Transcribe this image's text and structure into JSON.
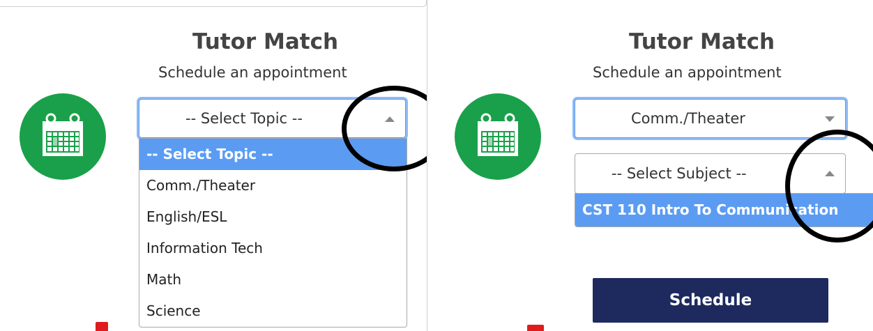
{
  "colors": {
    "calendar_green": "#1aa04a",
    "highlight_blue": "#5b9cf2",
    "focus_ring": "#8fbaf5",
    "button_navy": "#1e2a5e",
    "title_gray": "#444444"
  },
  "left": {
    "title": "Tutor Match",
    "subtitle": "Schedule an appointment",
    "topic_select": {
      "value": "-- Select Topic --",
      "state": "open",
      "arrow_icon": "chevron-up-icon"
    },
    "topic_options": [
      {
        "label": "-- Select Topic --",
        "highlighted": true
      },
      {
        "label": "Comm./Theater",
        "highlighted": false
      },
      {
        "label": "English/ESL",
        "highlighted": false
      },
      {
        "label": "Information Tech",
        "highlighted": false
      },
      {
        "label": "Math",
        "highlighted": false
      },
      {
        "label": "Science",
        "highlighted": false
      }
    ]
  },
  "right": {
    "title": "Tutor Match",
    "subtitle": "Schedule an appointment",
    "topic_select": {
      "value": "Comm./Theater",
      "arrow_icon": "chevron-down-icon"
    },
    "subject_select": {
      "value": "-- Select Subject --",
      "state": "open",
      "arrow_icon": "chevron-up-icon"
    },
    "subject_options": [
      {
        "label": "CST 110 Intro To Communication",
        "highlighted": true
      }
    ],
    "schedule_button": "Schedule"
  },
  "icons": {
    "calendar": "calendar-icon"
  }
}
